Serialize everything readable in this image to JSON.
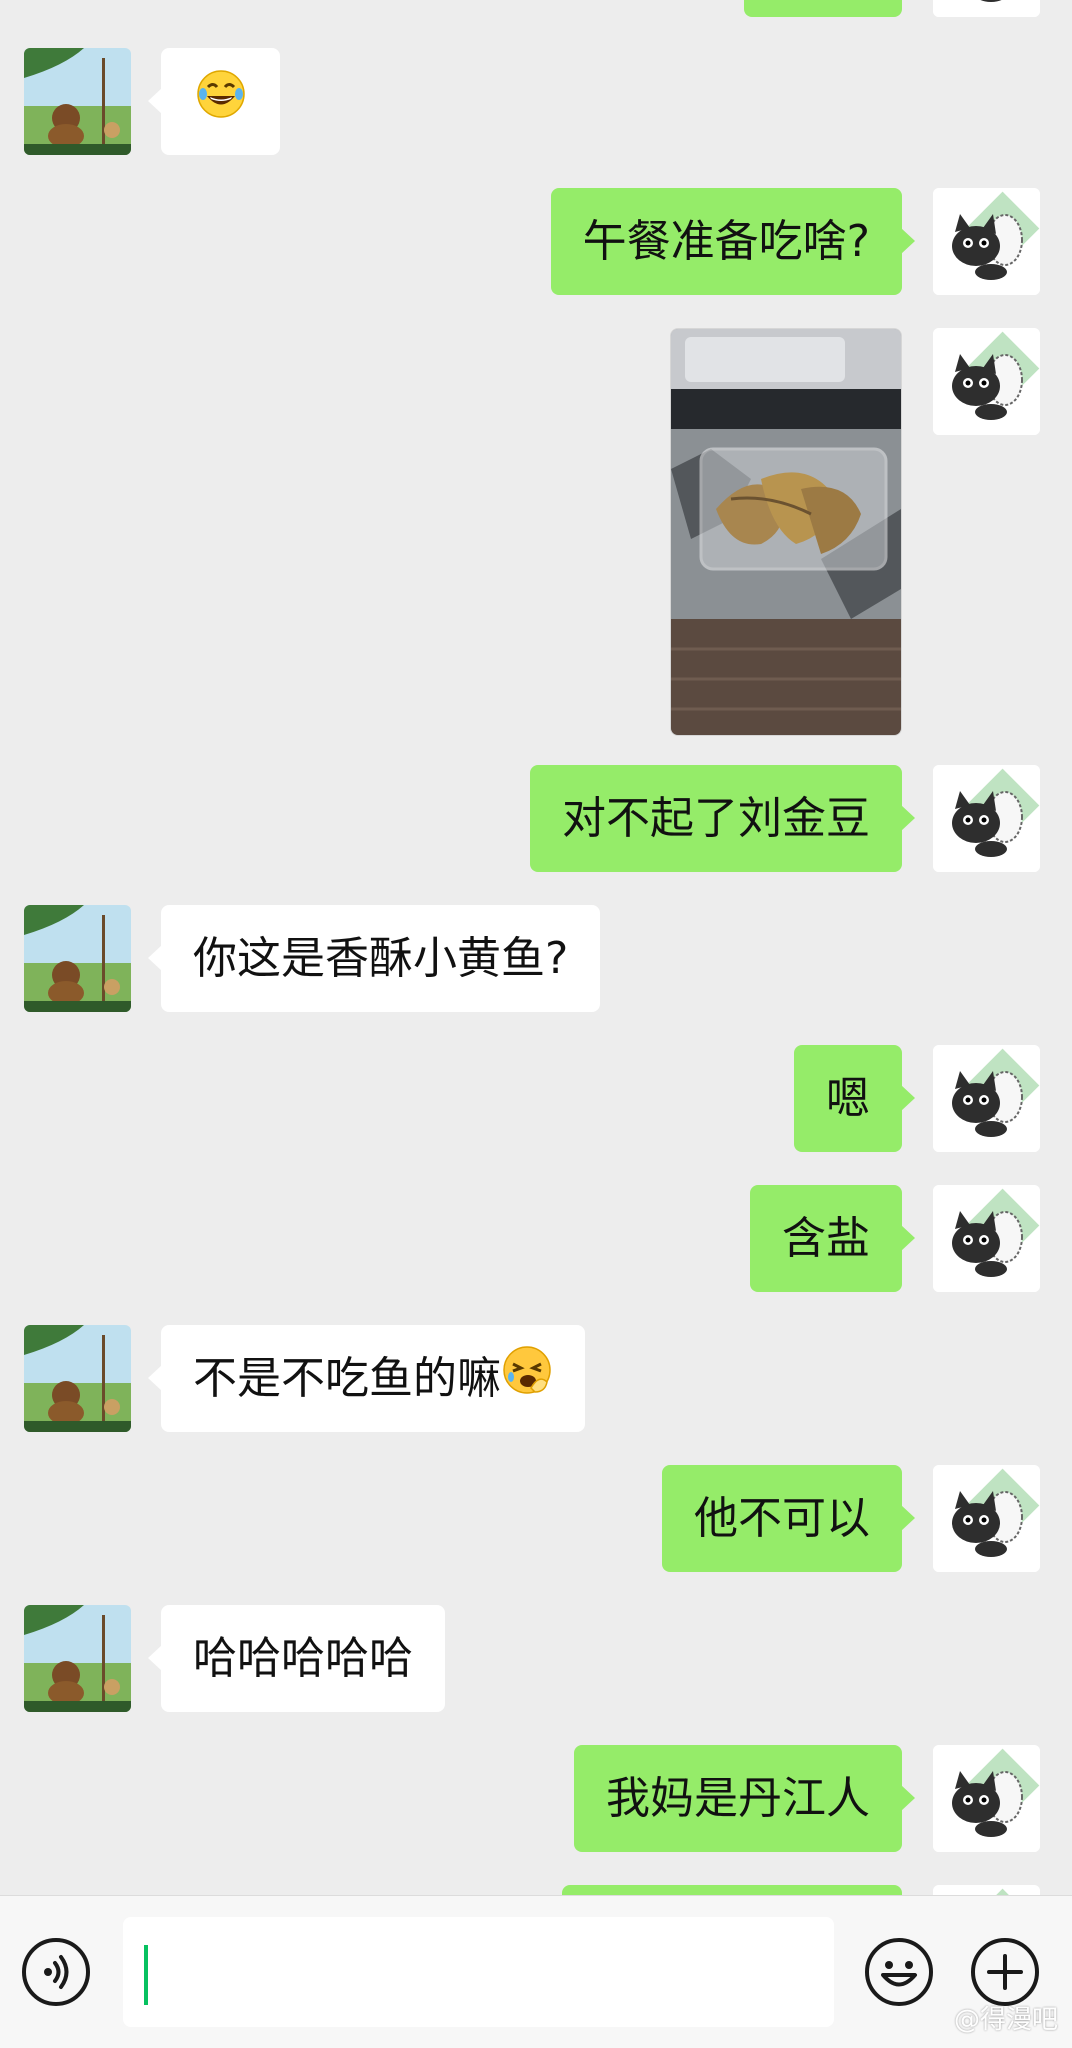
{
  "messages": [
    {
      "side": "right",
      "text": "",
      "partial": true
    },
    {
      "side": "left",
      "text": "😂"
    },
    {
      "side": "right",
      "text": "午餐准备吃啥?"
    },
    {
      "side": "right",
      "type": "image",
      "alt": "photo"
    },
    {
      "side": "right",
      "text": "对不起了刘金豆"
    },
    {
      "side": "left",
      "text": "你这是香酥小黄鱼?"
    },
    {
      "side": "right",
      "text": "嗯"
    },
    {
      "side": "right",
      "text": "含盐"
    },
    {
      "side": "left",
      "text": "不是不吃鱼的嘛",
      "emoji": "tired-face-emoji"
    },
    {
      "side": "right",
      "text": "他不可以"
    },
    {
      "side": "left",
      "text": "哈哈哈哈哈"
    },
    {
      "side": "right",
      "text": "我妈是丹江人"
    },
    {
      "side": "right",
      "text": "",
      "partial": true
    }
  ],
  "input": {
    "value": "",
    "voice_icon": "voice-icon",
    "emoji_icon": "emoji-icon",
    "plus_icon": "plus-icon"
  },
  "watermark": {
    "text": "@得漫吧"
  },
  "colors": {
    "self_bubble": "#95ec69",
    "other_bubble": "#ffffff",
    "background": "#ededed",
    "caret": "#07c160"
  }
}
